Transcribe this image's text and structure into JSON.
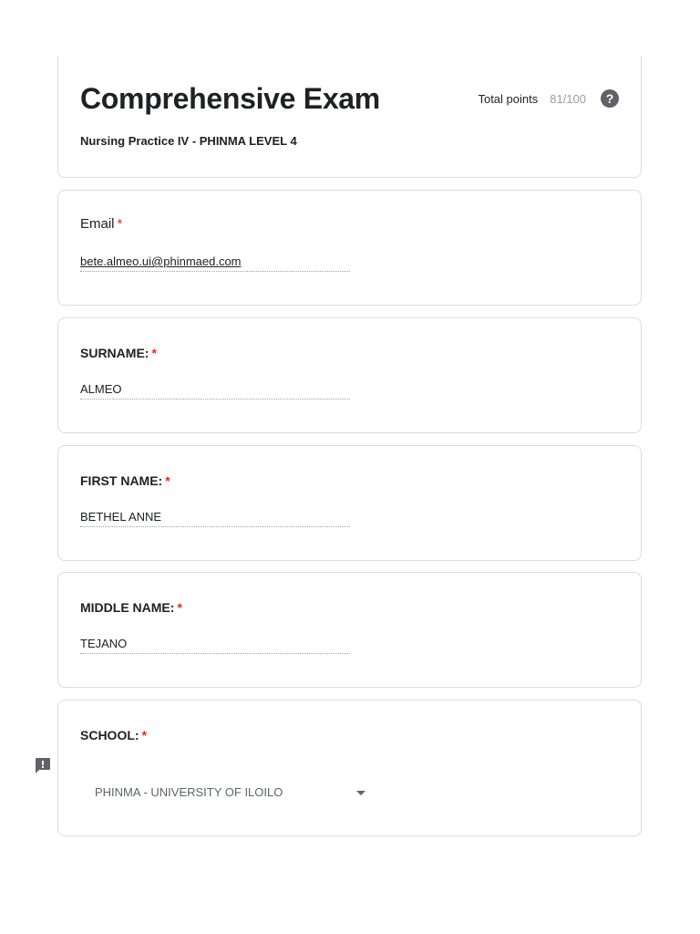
{
  "header": {
    "title": "Comprehensive Exam",
    "subtitle": "Nursing Practice IV - PHINMA LEVEL 4",
    "total_points_label": "Total points",
    "total_points_value": "81/100",
    "help_icon": "?"
  },
  "required_marker": "*",
  "questions": [
    {
      "label": "Email",
      "value": "bete.almeo.ui@phinmaed.com"
    },
    {
      "label": "SURNAME:",
      "value": "ALMEO"
    },
    {
      "label": "FIRST NAME:",
      "value": "BETHEL ANNE"
    },
    {
      "label": "MIDDLE NAME:",
      "value": "TEJANO"
    }
  ],
  "school": {
    "label": "SCHOOL:",
    "selected": "PHINMA - UNIVERSITY OF ILOILO"
  },
  "icons": {
    "help": "help-icon",
    "report": "report-issue-icon",
    "dropdown": "caret-down-icon"
  },
  "colors": {
    "required": "#d93025",
    "border": "#dadce0",
    "muted": "#9aa0a6"
  }
}
